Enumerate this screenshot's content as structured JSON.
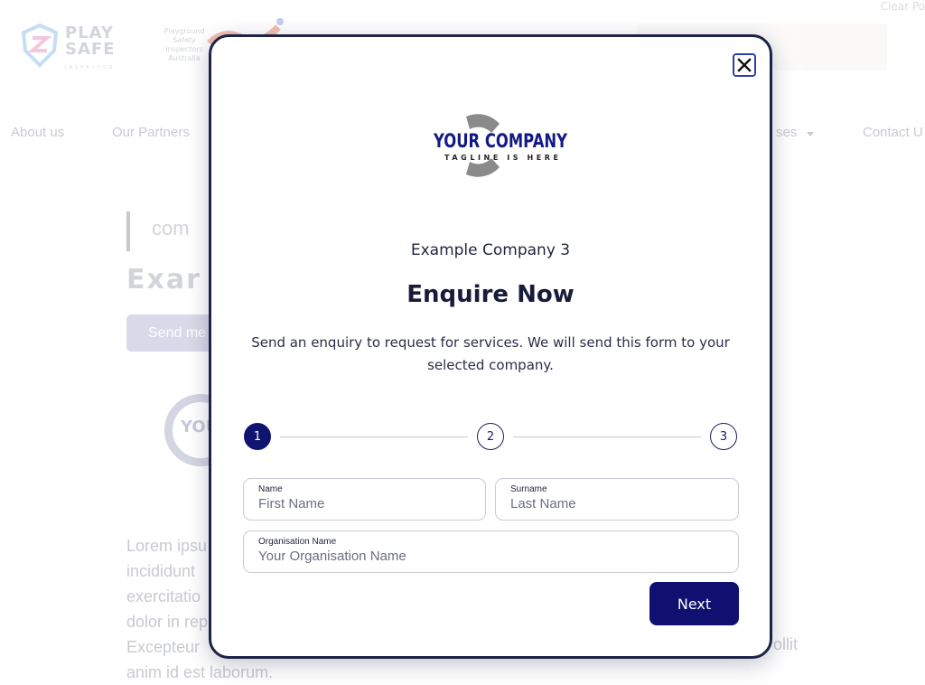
{
  "background": {
    "logo": {
      "brand_line1": "PLAY",
      "brand_line2": "SAFE",
      "brand_sub": "INSPECTOR"
    },
    "partner_logo_text": [
      "Playground",
      "Safety",
      "Inspectors",
      "Australia"
    ],
    "top_right_text": "Clear Po",
    "nav": {
      "about": "About us",
      "partners": "Our Partners",
      "courses_partial": "ses",
      "contact_partial": "Contact U"
    },
    "heading_partial": "com",
    "title_partial": "Exar",
    "send_button_partial": "Send me",
    "circle_logo_partial": "YOU",
    "lorem_lines": [
      "Lorem ipsu",
      "incididunt",
      "exercitatio",
      "dolor in rep",
      "Excepteur",
      "anim id est laborum."
    ],
    "lorem_right": "ollit"
  },
  "modal": {
    "logo": {
      "name": "YOUR COMPANY",
      "tagline": "TAGLINE IS HERE"
    },
    "company_name": "Example Company 3",
    "title": "Enquire Now",
    "description": "Send an enquiry to request for services. We will send this form to your selected company.",
    "steps": [
      "1",
      "2",
      "3"
    ],
    "current_step": 1,
    "fields": {
      "name": {
        "label": "Name",
        "placeholder": "First Name",
        "value": ""
      },
      "surname": {
        "label": "Surname",
        "placeholder": "Last Name",
        "value": ""
      },
      "organisation": {
        "label": "Organisation Name",
        "placeholder": "Your Organisation Name",
        "value": ""
      }
    },
    "next_label": "Next"
  },
  "colors": {
    "primary": "#0f1070",
    "modal_border": "#1d2248",
    "close_border": "#2b3fa8",
    "logo_blue": "#121a85",
    "logo_gray": "#8a8a8a"
  }
}
